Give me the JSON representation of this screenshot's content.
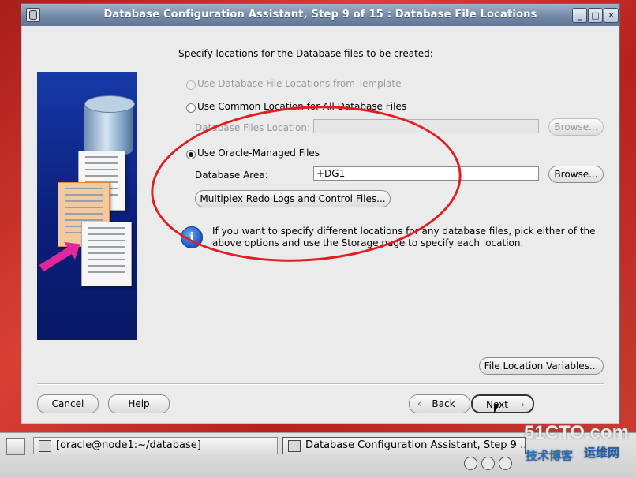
{
  "window": {
    "title": "Database Configuration Assistant, Step 9 of 15 : Database File Locations",
    "controls": {
      "minimize": "_",
      "maximize": "□",
      "close": "✕"
    }
  },
  "content": {
    "heading": "Specify locations for the Database files to be created:",
    "options": {
      "template": {
        "label": "Use Database File Locations from Template",
        "selected": false,
        "enabled": false
      },
      "common": {
        "label": "Use Common Location for All Database Files",
        "selected": false,
        "enabled": true
      },
      "omf": {
        "label": "Use Oracle-Managed Files",
        "selected": true,
        "enabled": true
      }
    },
    "common_location": {
      "label": "Database Files Location:",
      "value": "",
      "browse_label": "Browse..."
    },
    "database_area": {
      "label": "Database Area:",
      "value": "+DG1",
      "browse_label": "Browse..."
    },
    "multiplex_button": "Multiplex Redo Logs and Control Files...",
    "info_text_1": "If you want to specify different locations for any database files, pick either of the",
    "info_text_2": "above options and use the Storage page to specify each location.",
    "file_location_variables": "File Location Variables..."
  },
  "footer": {
    "cancel": "Cancel",
    "help": "Help",
    "back": "Back",
    "next": "Next"
  },
  "taskbar": {
    "task1": "[oracle@node1:~/database]",
    "task2": "Database Configuration Assistant, Step 9 ..."
  },
  "watermark": {
    "line1": "51CTO.com",
    "line2": "技术博客",
    "line3": "运维网"
  },
  "colors": {
    "titlebar": "#6f87a4",
    "window_bg": "#ebebeb",
    "annotation": "#e02020",
    "desktop": "#c9302a"
  }
}
